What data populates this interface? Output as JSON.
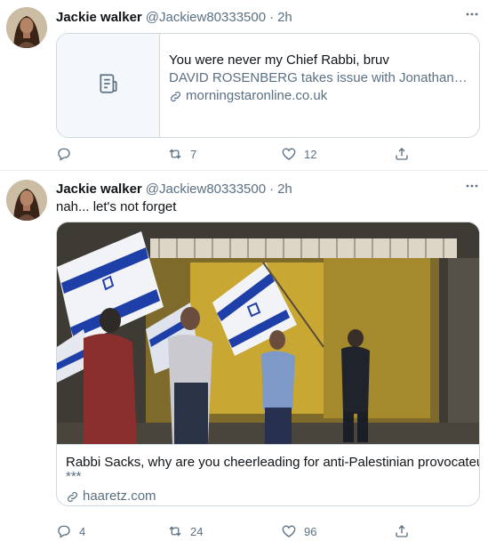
{
  "tweets": [
    {
      "author": {
        "name": "Jackie walker",
        "handle": "@Jackiew80333500",
        "separator": "·",
        "time": "2h"
      },
      "more_icon": "more-horizontal-icon",
      "card": {
        "title": "You were never my Chief Rabbi, bruv",
        "description": "DAVID ROSENBERG takes issue with Jonathan Sacks’s attack on Jeremy Corbyn and the former’s position o...",
        "domain": "morningstaronline.co.uk",
        "thumb_icon": "article-icon"
      },
      "actions": {
        "reply": "",
        "retweet": "7",
        "like": "12",
        "share": ""
      }
    },
    {
      "author": {
        "name": "Jackie walker",
        "handle": "@Jackiew80333500",
        "separator": "·",
        "time": "2h"
      },
      "more_icon": "more-horizontal-icon",
      "text": "nah... let's not forget",
      "card": {
        "title": "Rabbi Sacks, why are you cheerleading for anti-Palestinian provocateurs?",
        "description": "***",
        "domain": "haaretz.com"
      },
      "actions": {
        "reply": "4",
        "retweet": "24",
        "like": "96",
        "share": ""
      }
    }
  ],
  "colors": {
    "text": "#0f1419",
    "secondary": "#5b7083",
    "border": "#cfd9de",
    "flag_blue": "#1f3fa8"
  }
}
